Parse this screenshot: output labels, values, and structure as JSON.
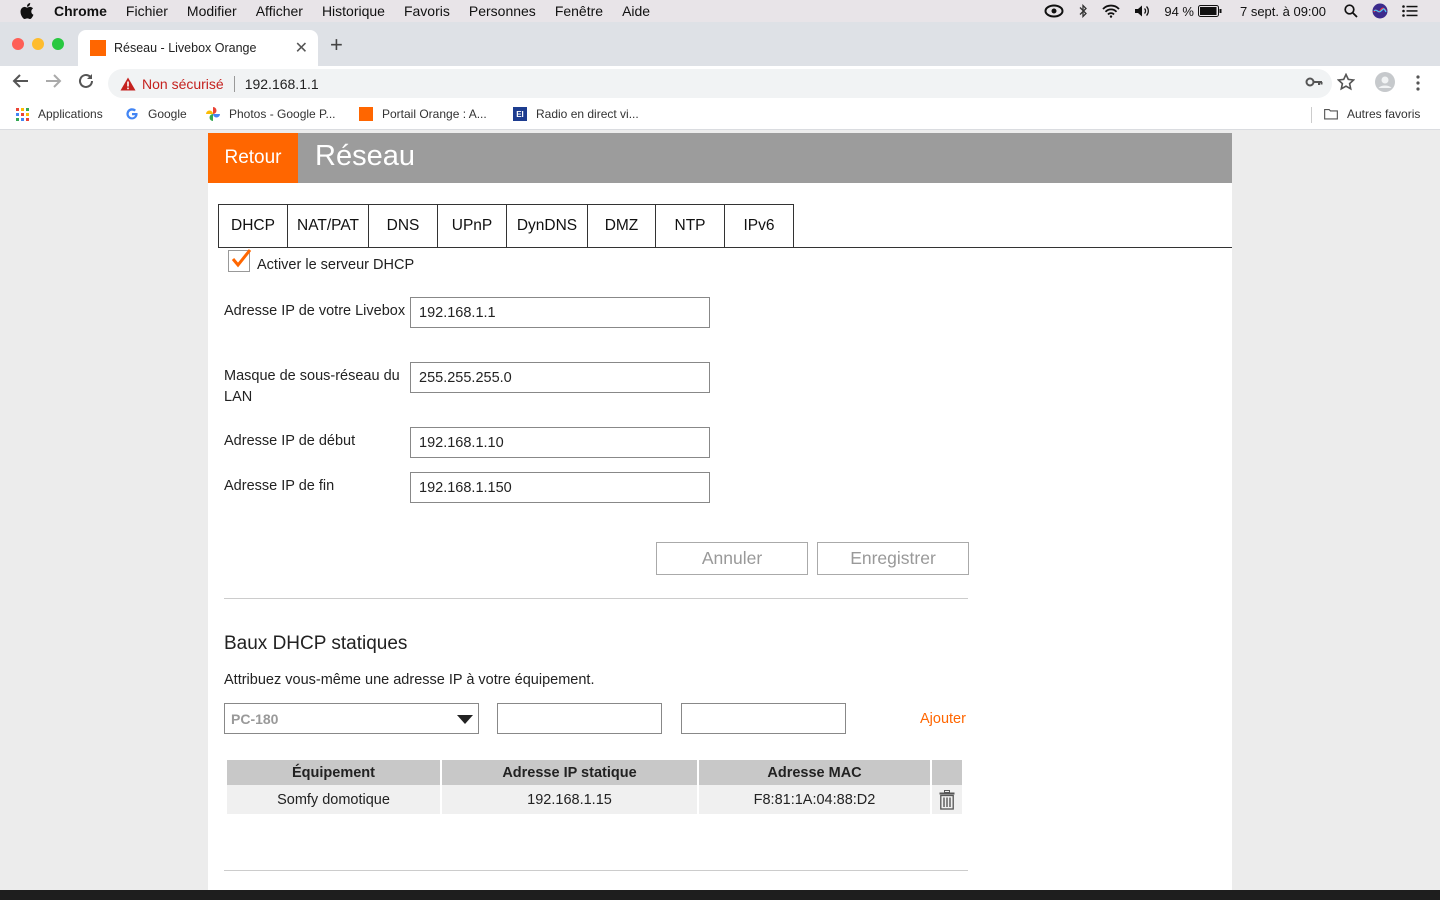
{
  "menubar": {
    "app": "Chrome",
    "items": [
      "Fichier",
      "Modifier",
      "Afficher",
      "Historique",
      "Favoris",
      "Personnes",
      "Fenêtre",
      "Aide"
    ],
    "battery": "94 %",
    "datetime": "7 sept. à  09:00"
  },
  "browser": {
    "tab_title": "Réseau - Livebox Orange",
    "security_label": "Non sécurisé",
    "url": "192.168.1.1",
    "bookmarks": {
      "apps": "Applications",
      "google": "Google",
      "photos": "Photos - Google P...",
      "orange": "Portail Orange : A...",
      "radio": "Radio en direct vi...",
      "others": "Autres favoris"
    },
    "colors": {
      "tabstrip": "#dee1e6",
      "warning": "#c5221f"
    }
  },
  "page": {
    "back_label": "Retour",
    "title": "Réseau",
    "colors": {
      "accent": "#ff6600",
      "header": "#9c9c9c"
    },
    "tabs": [
      "DHCP",
      "NAT/PAT",
      "DNS",
      "UPnP",
      "DynDNS",
      "DMZ",
      "NTP",
      "IPv6"
    ],
    "active_tab": "DHCP",
    "dhcp": {
      "enable_label": "Activer le serveur DHCP",
      "enabled": true,
      "fields": {
        "livebox_ip_label": "Adresse IP de votre Livebox",
        "livebox_ip_value": "192.168.1.1",
        "subnet_label": "Masque de sous-réseau du LAN",
        "subnet_value": "255.255.255.0",
        "start_label": "Adresse IP de début",
        "start_value": "192.168.1.10",
        "end_label": "Adresse IP de fin",
        "end_value": "192.168.1.150"
      },
      "cancel_label": "Annuler",
      "save_label": "Enregistrer"
    },
    "static_leases": {
      "title": "Baux DHCP statiques",
      "description": "Attribuez vous-même une adresse IP à votre équipement.",
      "device_select_value": "PC-180",
      "add_label": "Ajouter",
      "columns": [
        "Équipement",
        "Adresse IP statique",
        "Adresse MAC"
      ],
      "rows": [
        {
          "device": "Somfy domotique",
          "ip": "192.168.1.15",
          "mac": "F8:81:1A:04:88:D2"
        }
      ]
    }
  }
}
